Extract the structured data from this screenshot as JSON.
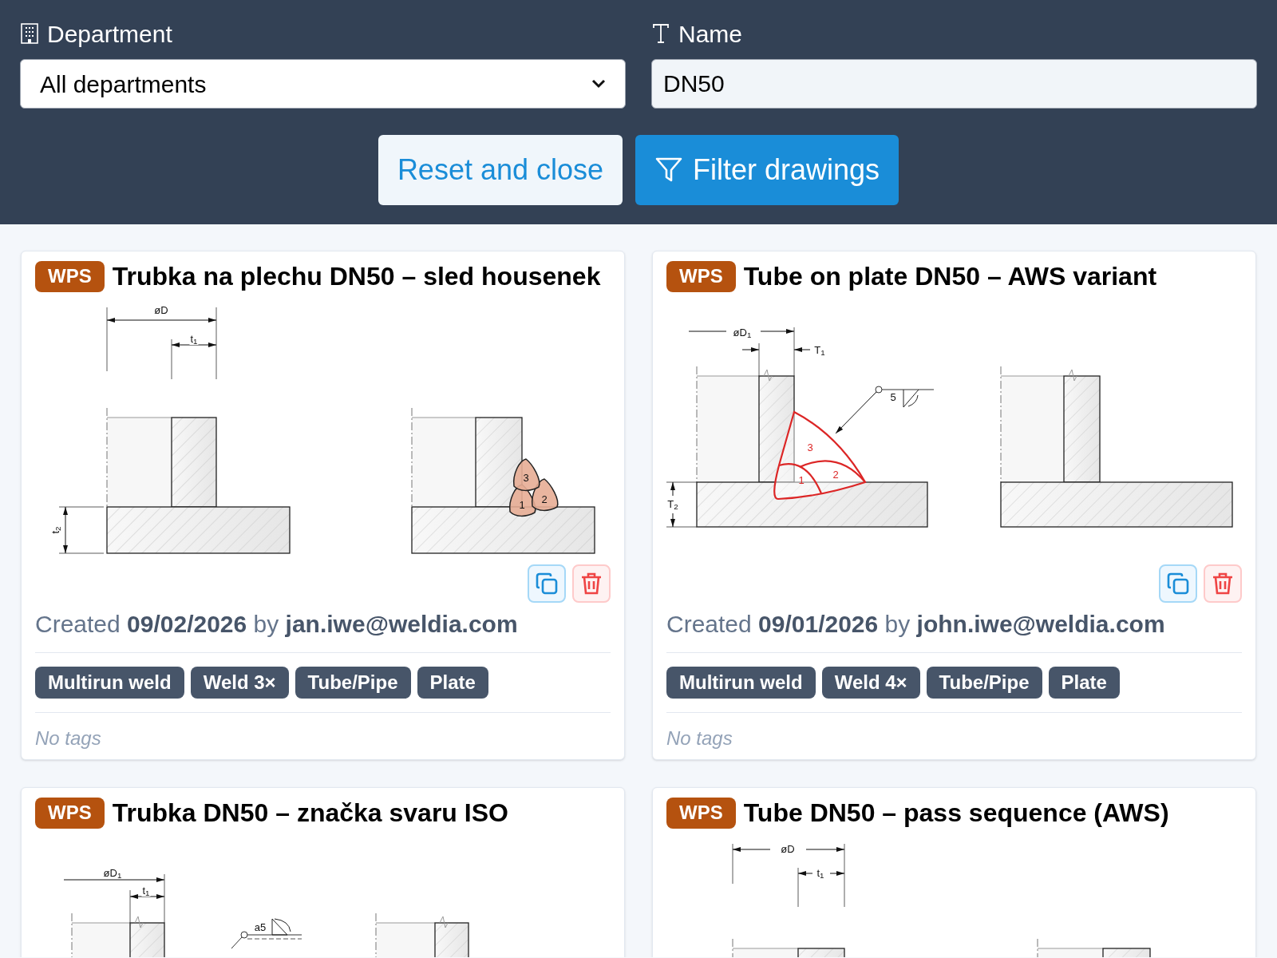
{
  "filters": {
    "department": {
      "label": "Department",
      "value": "All departments"
    },
    "name": {
      "label": "Name",
      "value": "DN50"
    }
  },
  "buttons": [
    {
      "label": "Reset and close",
      "kind": "secondary"
    },
    {
      "label": "Filter drawings",
      "kind": "primary"
    }
  ],
  "cards": [
    {
      "badge": "WPS",
      "title": "Trubka na plechu DN50 – sled housenek",
      "drawing": {
        "kind": "iso_beads",
        "labels": [
          "øD",
          "t$_{1}$",
          "t$_{2}$",
          "3",
          "1",
          "2"
        ]
      },
      "created": "Created **09/02/2026** by **jan.iwe@weldia.com**",
      "tags": [
        "Multirun weld",
        "Weld 3×",
        "Tube/Pipe",
        "Plate"
      ],
      "note": "No tags"
    },
    {
      "badge": "WPS",
      "title": "Tube on plate DN50 – AWS variant",
      "drawing": {
        "kind": "aws_red",
        "labels": [
          "øD$_{1}$",
          "T$_{1}$",
          "5",
          "3",
          "2",
          "1",
          "T$_{2}$"
        ]
      },
      "created": "Created **09/01/2026** by **john.iwe@weldia.com**",
      "tags": [
        "Multirun weld",
        "Weld 4×",
        "Tube/Pipe",
        "Plate"
      ],
      "note": "No tags"
    },
    {
      "badge": "WPS",
      "title": "Trubka DN50 – značka svaru ISO",
      "drawing": {
        "kind": "iso_symbol",
        "labels": [
          "øD$_{1}$",
          "t$_{1}$",
          "a5"
        ]
      }
    },
    {
      "badge": "WPS",
      "title": "Tube DN50 – pass sequence (AWS)",
      "drawing": {
        "kind": "aws_plain",
        "labels": [
          "øD",
          "t$_{1}$"
        ]
      }
    }
  ]
}
